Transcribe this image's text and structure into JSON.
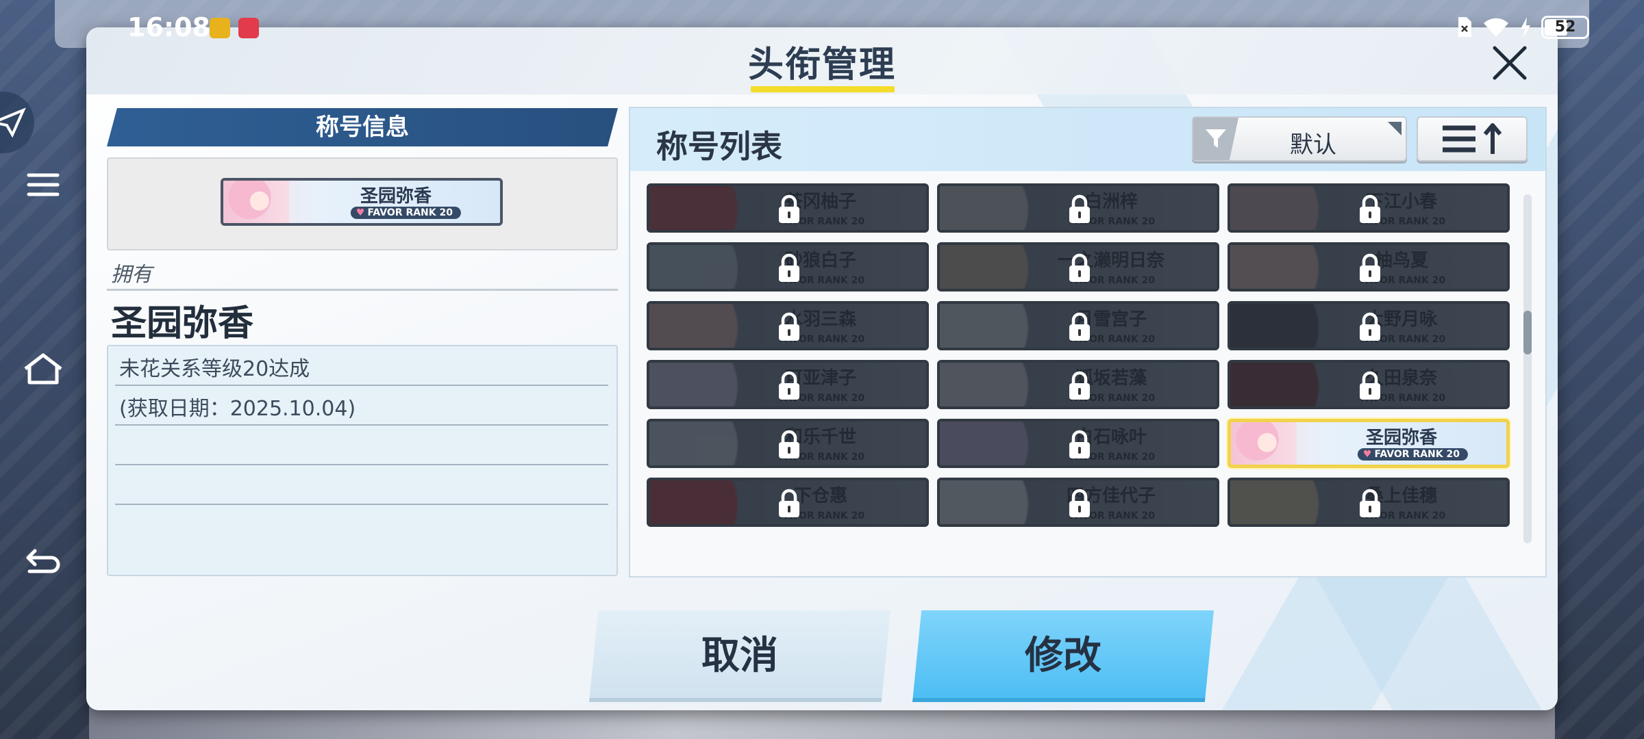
{
  "status_bar": {
    "time": "16:08",
    "battery": "52"
  },
  "dialog": {
    "title": "头衔管理",
    "close": "✕"
  },
  "title_info": {
    "header": "称号信息",
    "preview": {
      "name": "圣园弥香",
      "rank": "FAVOR RANK 20"
    },
    "own_label": "拥有",
    "own_name": "圣园弥香",
    "condition": "未花关系等级20达成",
    "acquired": "(获取日期：2025.10.04)"
  },
  "title_list": {
    "header": "称号列表",
    "filter_label": "默认",
    "rank_text": "FAVOR RANK 20",
    "tiles": [
      {
        "name": "茶冈柚子",
        "locked": true
      },
      {
        "name": "白洲梓",
        "locked": true
      },
      {
        "name": "下江小春",
        "locked": true
      },
      {
        "name": "砂狼白子",
        "locked": true
      },
      {
        "name": "一之濑明日奈",
        "locked": true
      },
      {
        "name": "柚鸟夏",
        "locked": true
      },
      {
        "name": "水羽三森",
        "locked": true
      },
      {
        "name": "月雪宫子",
        "locked": true
      },
      {
        "name": "大野月咏",
        "locked": true
      },
      {
        "name": "可亚津子",
        "locked": true
      },
      {
        "name": "狐坂若藻",
        "locked": true
      },
      {
        "name": "久田泉奈",
        "locked": true
      },
      {
        "name": "和乐千世",
        "locked": true
      },
      {
        "name": "白石咏叶",
        "locked": true
      },
      {
        "name": "圣园弥香",
        "locked": false,
        "selected": true
      },
      {
        "name": "下仓惠",
        "locked": true
      },
      {
        "name": "四方佳代子",
        "locked": true
      },
      {
        "name": "桑上佳穗",
        "locked": true
      }
    ]
  },
  "buttons": {
    "cancel": "取消",
    "modify": "修改"
  },
  "colors": {
    "accent": "#4bbdf3",
    "header_blue": "#2f5f94",
    "highlight": "#f1d24c",
    "underline": "#f4dc2a"
  }
}
